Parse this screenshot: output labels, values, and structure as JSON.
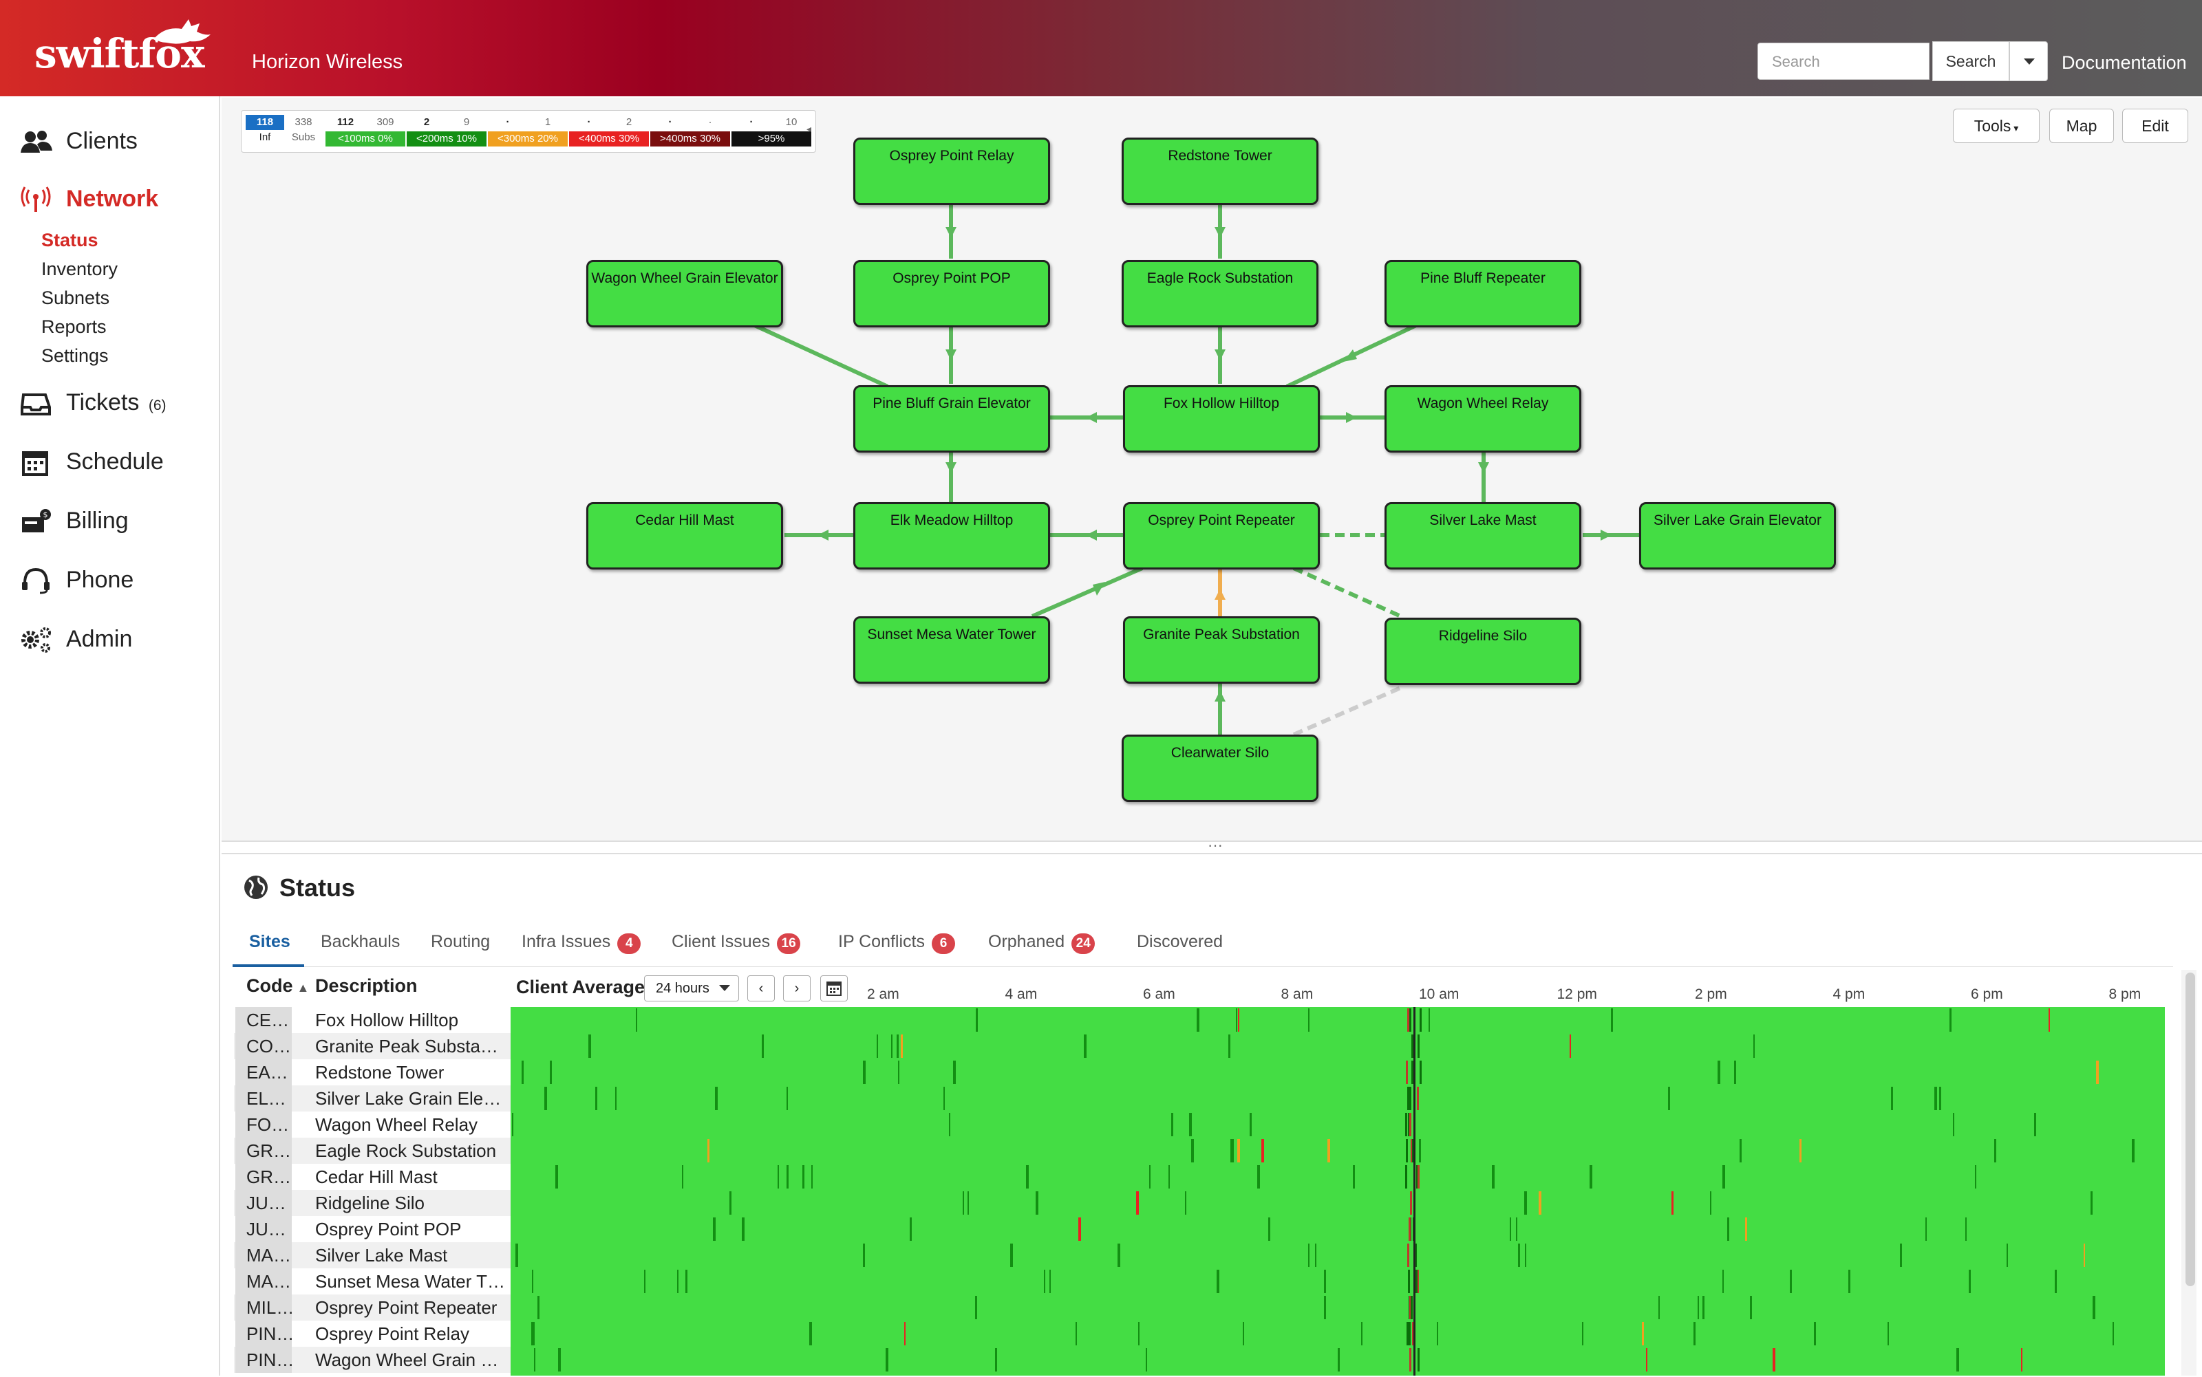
{
  "header": {
    "logo": "swiftfox",
    "company": "Horizon Wireless",
    "search_placeholder": "Search",
    "search_button": "Search",
    "documentation": "Documentation"
  },
  "sidebar": {
    "clients": "Clients",
    "network": "Network",
    "network_sub": [
      "Status",
      "Inventory",
      "Subnets",
      "Reports",
      "Settings"
    ],
    "tickets": "Tickets",
    "tickets_count": "(6)",
    "schedule": "Schedule",
    "billing": "Billing",
    "phone": "Phone",
    "admin": "Admin"
  },
  "legend": {
    "inf_count": "118",
    "inf_label": "Inf",
    "subs_count": "338",
    "subs_label": "Subs",
    "cells": [
      {
        "a": "112",
        "b": "309",
        "label": "<100ms 0%",
        "color": "#33b833"
      },
      {
        "a": "2",
        "b": "9",
        "label": "<200ms 10%",
        "color": "#138f13"
      },
      {
        "a": "·",
        "b": "1",
        "label": "<300ms 20%",
        "color": "#f0a020"
      },
      {
        "a": "·",
        "b": "2",
        "label": "<400ms 30%",
        "color": "#e82222"
      },
      {
        "a": "·",
        "b": "·",
        "label": ">400ms 30%",
        "color": "#7a0e0e"
      },
      {
        "a": "·",
        "b": "10",
        "label": ">95%",
        "color": "#111111"
      }
    ]
  },
  "toolbar": {
    "tools": "Tools",
    "map": "Map",
    "edit": "Edit"
  },
  "nodes": {
    "osprey_point_relay": "Osprey Point Relay",
    "redstone_tower": "Redstone Tower",
    "wagon_wheel_grain_elevator": "Wagon Wheel Grain Elevator",
    "osprey_point_pop": "Osprey Point POP",
    "eagle_rock_substation": "Eagle Rock Substation",
    "pine_bluff_repeater": "Pine Bluff Repeater",
    "pine_bluff_grain_elevator": "Pine Bluff Grain Elevator",
    "fox_hollow_hilltop": "Fox Hollow Hilltop",
    "wagon_wheel_relay": "Wagon Wheel Relay",
    "cedar_hill_mast": "Cedar Hill Mast",
    "elk_meadow_hilltop": "Elk Meadow Hilltop",
    "osprey_point_repeater": "Osprey Point Repeater",
    "silver_lake_mast": "Silver Lake Mast",
    "silver_lake_grain_elevator": "Silver Lake Grain Elevator",
    "sunset_mesa_water_tower": "Sunset Mesa Water Tower",
    "granite_peak_substation": "Granite Peak Substation",
    "ridgeline_silo": "Ridgeline Silo",
    "clearwater_silo": "Clearwater Silo"
  },
  "colors": {
    "node_fill": "#44dd44",
    "link": "#5cb85c",
    "link_warn": "#f0ad4e",
    "link_down": "#cccccc",
    "accent": "#d42a26",
    "tab_active": "#1a5fa0"
  },
  "status": {
    "title": "Status",
    "tabs": [
      {
        "label": "Sites",
        "badge": ""
      },
      {
        "label": "Backhauls",
        "badge": ""
      },
      {
        "label": "Routing",
        "badge": ""
      },
      {
        "label": "Infra Issues",
        "badge": "4"
      },
      {
        "label": "Client Issues",
        "badge": "16"
      },
      {
        "label": "IP Conflicts",
        "badge": "6"
      },
      {
        "label": "Orphaned",
        "badge": "24"
      },
      {
        "label": "Discovered",
        "badge": ""
      }
    ],
    "col_code": "Code",
    "col_desc": "Description",
    "client_average": "Client Average",
    "range": "24 hours",
    "prev": "‹",
    "next": "›",
    "time_ticks": [
      "2 am",
      "4 am",
      "6 am",
      "8 am",
      "10 am",
      "12 pm",
      "2 pm",
      "4 pm",
      "6 pm",
      "8 pm"
    ],
    "rows": [
      {
        "code": "CE…",
        "desc": "Fox Hollow Hilltop"
      },
      {
        "code": "CO…",
        "desc": "Granite Peak Substa…"
      },
      {
        "code": "EA…",
        "desc": "Redstone Tower"
      },
      {
        "code": "EL…",
        "desc": "Silver Lake Grain Ele…"
      },
      {
        "code": "FO…",
        "desc": "Wagon Wheel Relay"
      },
      {
        "code": "GR…",
        "desc": "Eagle Rock Substation"
      },
      {
        "code": "GR…",
        "desc": "Cedar Hill Mast"
      },
      {
        "code": "JU…",
        "desc": "Ridgeline Silo"
      },
      {
        "code": "JU…",
        "desc": "Osprey Point POP"
      },
      {
        "code": "MA…",
        "desc": "Silver Lake Mast"
      },
      {
        "code": "MA…",
        "desc": "Sunset Mesa Water T…"
      },
      {
        "code": "MIL…",
        "desc": "Osprey Point Repeater"
      },
      {
        "code": "PIN…",
        "desc": "Osprey Point Relay"
      },
      {
        "code": "PIN…",
        "desc": "Wagon Wheel Grain …"
      }
    ]
  }
}
